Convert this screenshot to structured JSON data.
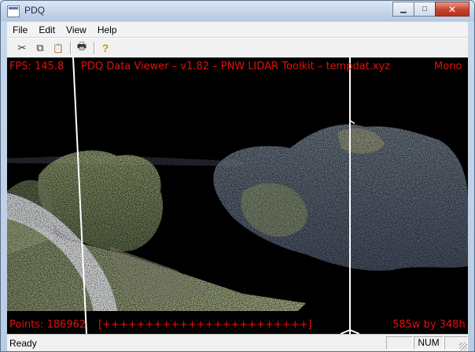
{
  "window": {
    "title": "PDQ"
  },
  "caption_buttons": {
    "minimize": "▁",
    "maximize": "□",
    "close": "✕"
  },
  "menu": [
    "File",
    "Edit",
    "View",
    "Help"
  ],
  "toolbar": {
    "icons": [
      "cut-icon",
      "copy-icon",
      "paste-icon",
      "print-icon",
      "help-icon"
    ],
    "glyphs": {
      "cut": "✂",
      "copy": "⧉",
      "paste": "📋",
      "print": "🖶",
      "help": "?"
    }
  },
  "viewer": {
    "fps_text": "FPS: 145.8",
    "title_text": "PDQ Data Viewer – v1.82 – PNW LIDAR Toolkit – tempdat.xyz",
    "mode_text": "Mono",
    "points_text": "Points: 186962",
    "progress_text": "[++++++++++++++++++++++++]",
    "size_text": "585w by 348h",
    "hud_color": "#e01010"
  },
  "status": {
    "text": "Ready",
    "indicator": "NUM"
  }
}
